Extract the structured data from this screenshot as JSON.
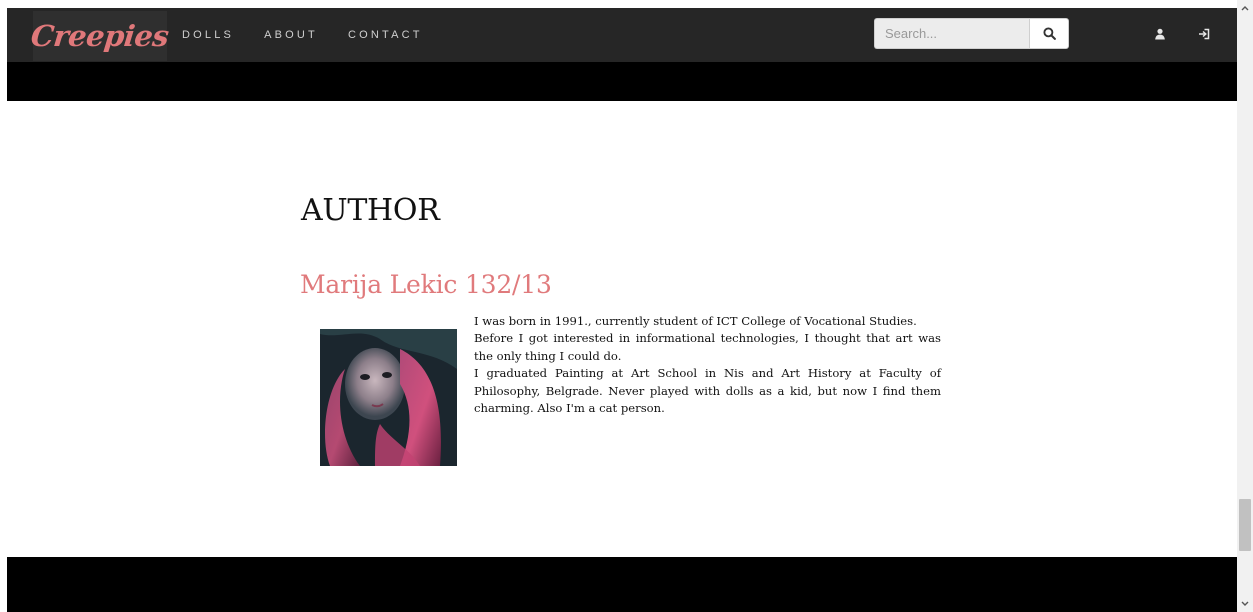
{
  "navbar": {
    "logo": "Creepies",
    "links": [
      {
        "label": "DOLLS"
      },
      {
        "label": "ABOUT"
      },
      {
        "label": "CONTACT"
      }
    ],
    "search": {
      "placeholder": "Search...",
      "value": ""
    },
    "icons": {
      "search": "search-icon",
      "user": "user-icon",
      "login": "sign-in-icon"
    }
  },
  "main": {
    "title": "AUTHOR",
    "author_name": "Marija Lekic 132/13",
    "photo": "author-photo",
    "bio": [
      "I was born in 1991., currently student of ICT College of Vocational Studies.",
      "Before I got interested in informational technologies, I thought that art was the only thing I could do.",
      "I graduated Painting at Art School in Nis and Art History at Faculty of Philosophy, Belgrade. Never played with dolls as a kid, but now I find them charming. Also I'm a cat person."
    ]
  },
  "colors": {
    "navbar_bg": "#262626",
    "accent": "#e07a7c",
    "band": "#000000"
  }
}
